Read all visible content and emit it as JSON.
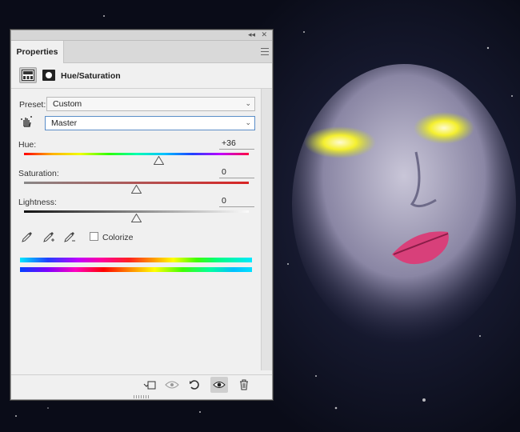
{
  "panel": {
    "tab_label": "Properties",
    "collapse_glyph": "◂◂",
    "close_glyph": "✕",
    "adjustment_title": "Hue/Saturation",
    "preset": {
      "label": "Preset:",
      "value": "Custom"
    },
    "channel": {
      "value": "Master"
    },
    "hue": {
      "label": "Hue:",
      "value": "+36",
      "level": 36,
      "min": -180,
      "max": 180
    },
    "saturation": {
      "label": "Saturation:",
      "value": "0",
      "level": 0,
      "min": -100,
      "max": 100
    },
    "lightness": {
      "label": "Lightness:",
      "value": "0",
      "level": 0,
      "min": -100,
      "max": 100
    },
    "colorize": {
      "label": "Colorize",
      "checked": false
    },
    "icons": {
      "header": [
        "hue-saturation-adjustment-icon",
        "layer-mask-icon"
      ],
      "targeted_adjustment": "hand-adjust-icon",
      "eyedroppers": [
        "eyedropper-icon",
        "eyedropper-add-icon",
        "eyedropper-subtract-icon"
      ],
      "footer": [
        "clip-to-layer-icon",
        "view-previous-state-icon",
        "reset-icon",
        "visibility-eye-icon",
        "delete-trash-icon"
      ]
    }
  }
}
